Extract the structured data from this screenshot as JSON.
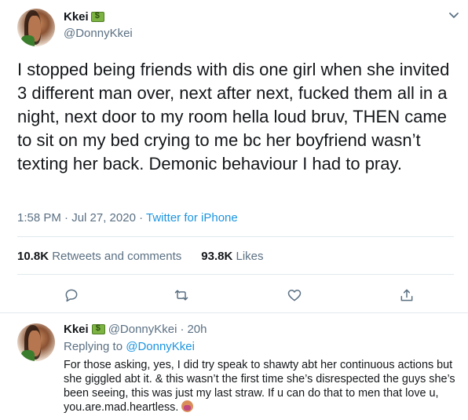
{
  "main_tweet": {
    "display_name": "Kkei",
    "handle": "@DonnyKkei",
    "text": "I stopped being friends with dis one girl when she invited 3 different man over, next after next, fucked them all in a night, next door to my room hella loud bruv, THEN came to sit on my bed crying to me bc her boyfriend wasn’t texting her back. Demonic behaviour I had to pray.",
    "time": "1:58 PM · Jul 27, 2020 ·",
    "source": "Twitter for iPhone",
    "retweets_count": "10.8K",
    "retweets_label": "Retweets and comments",
    "likes_count": "93.8K",
    "likes_label": "Likes",
    "name_emoji": "money-with-wings",
    "menu_icon": "chevron-down-icon"
  },
  "actions": [
    "reply-icon",
    "retweet-icon",
    "like-icon",
    "share-icon"
  ],
  "reply_tweet": {
    "display_name": "Kkei",
    "handle": "@DonnyKkei",
    "dot": "·",
    "time_ago": "20h",
    "replying_prefix": "Replying to",
    "replying_to": "@DonnyKkei",
    "text": "For those asking, yes, I did try speak to shawty abt her continuous actions but she giggled abt it. & this wasn’t the first time she’s disrespected the guys she’s been seeing, this was just my last straw. If u can do that to men that love u, you.are.mad.heartless.",
    "end_emoji": "woman-facepalming"
  },
  "colors": {
    "text": "#14171a",
    "secondary": "#5b7083",
    "link": "#1b95e0",
    "border": "#e1e8ed"
  }
}
